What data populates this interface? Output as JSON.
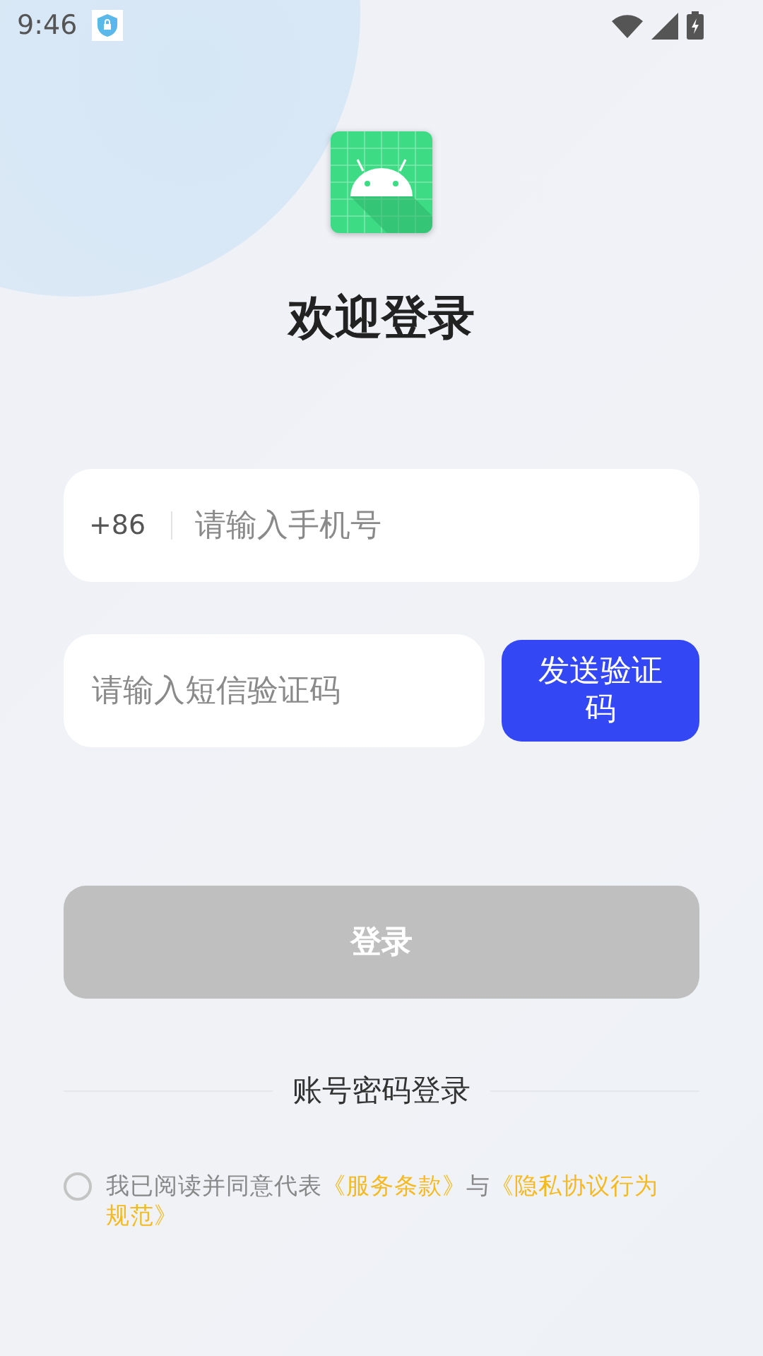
{
  "status_bar": {
    "time": "9:46"
  },
  "title": "欢迎登录",
  "phone_field": {
    "country_code": "+86",
    "placeholder": "请输入手机号"
  },
  "code_field": {
    "placeholder": "请输入短信验证码"
  },
  "send_code_button": {
    "label": "发送验证码"
  },
  "login_button": {
    "label": "登录",
    "disabled": true
  },
  "password_login_link": {
    "label": "账号密码登录"
  },
  "agreement": {
    "checked": false,
    "parts": [
      {
        "kind": "plain",
        "text": "我已阅读并同意代表"
      },
      {
        "kind": "link",
        "text": "《服务条款》"
      },
      {
        "kind": "plain",
        "text": "与"
      },
      {
        "kind": "link",
        "text": "《隐私协议行为"
      },
      {
        "kind": "link",
        "text": "规范》"
      }
    ]
  }
}
